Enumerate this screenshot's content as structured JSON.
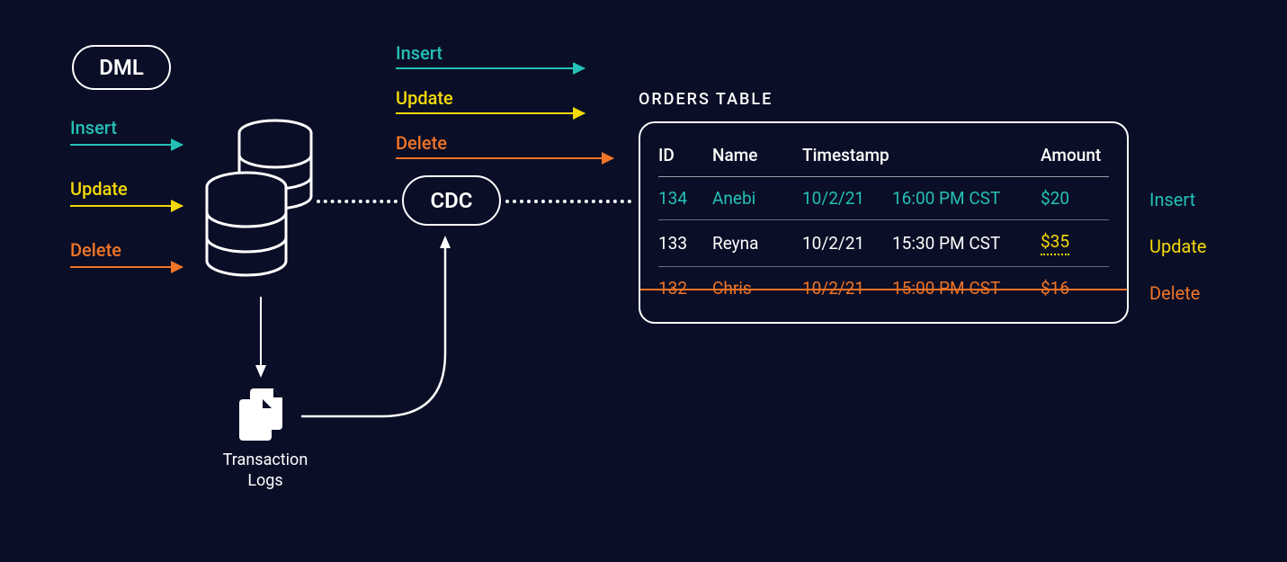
{
  "dml": {
    "label": "DML"
  },
  "cdc": {
    "label": "CDC"
  },
  "ops": {
    "insert": "Insert",
    "update": "Update",
    "delete": "Delete"
  },
  "tlogs": {
    "label_line1": "Transaction",
    "label_line2": "Logs"
  },
  "orders": {
    "title": "ORDERS TABLE",
    "headers": {
      "id": "ID",
      "name": "Name",
      "timestamp": "Timestamp",
      "amount": "Amount"
    },
    "rows": [
      {
        "id": "134",
        "name": "Anebi",
        "date": "10/2/21",
        "time": "16:00 PM CST",
        "amount": "$20",
        "op": "Insert"
      },
      {
        "id": "133",
        "name": "Reyna",
        "date": "10/2/21",
        "time": "15:30 PM CST",
        "amount": "$35",
        "op": "Update"
      },
      {
        "id": "132",
        "name": "Chris",
        "date": "10/2/21",
        "time": "15:00 PM CST",
        "amount": "$16",
        "op": "Delete"
      }
    ]
  },
  "colors": {
    "insert": "#24c0b5",
    "update": "#f5d90a",
    "delete": "#f07427",
    "bg": "#0a0e26",
    "stroke": "#ffffff"
  }
}
